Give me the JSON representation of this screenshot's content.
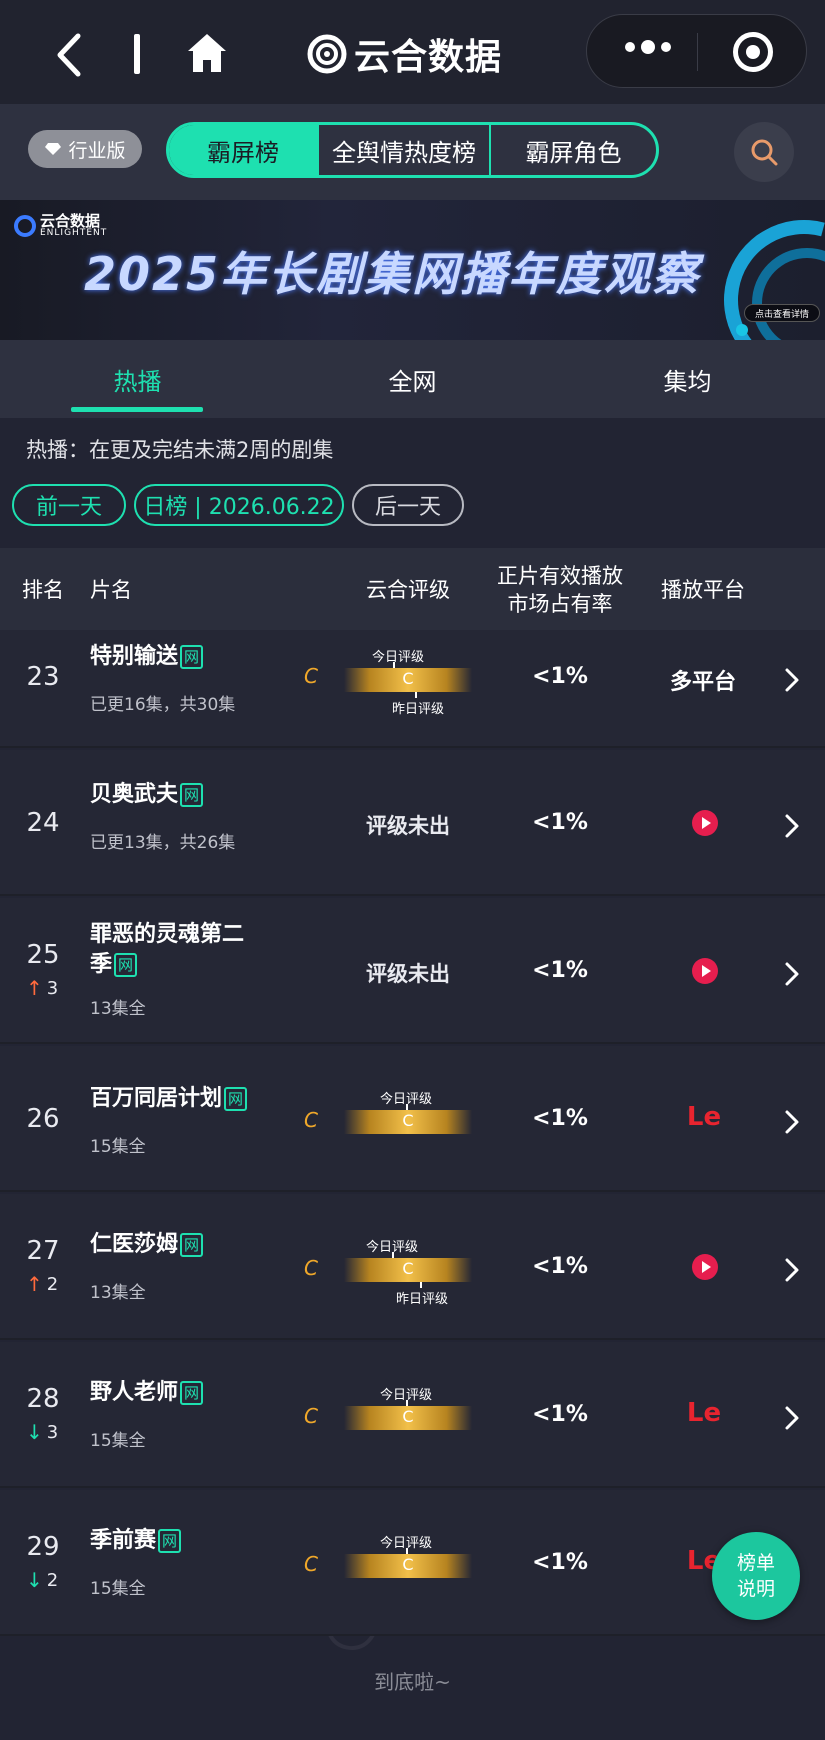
{
  "app": {
    "title": "云合数据"
  },
  "toolbar": {
    "edition_label": "行业版"
  },
  "tabs": [
    {
      "label": "霸屏榜",
      "active": true
    },
    {
      "label": "全舆情热度榜",
      "active": false
    },
    {
      "label": "霸屏角色",
      "active": false
    }
  ],
  "banner": {
    "logo_cn": "云合数据",
    "logo_en": "ENLIGHTENT",
    "title": "2025年长剧集网播年度观察",
    "button": "点击查看详情"
  },
  "subtabs": [
    {
      "label": "热播",
      "active": true
    },
    {
      "label": "全网",
      "active": false
    },
    {
      "label": "集均",
      "active": false
    }
  ],
  "description": "热播：在更及完结未满2周的剧集",
  "datebar": {
    "prev": "前一天",
    "current": "日榜 | 2026.06.22",
    "next": "后一天"
  },
  "table": {
    "headers": {
      "rank": "排名",
      "name": "片名",
      "grade": "云合评级",
      "share_line1": "正片有效播放",
      "share_line2": "市场占有率",
      "platform": "播放平台"
    },
    "rows": [
      {
        "rank": "23",
        "change": "",
        "name": "特别输送",
        "tag": "网",
        "episodes": "已更16集，共30集",
        "grade": "C",
        "grade_mid": "C",
        "label_today": "今日评级",
        "label_yesterday": "昨日评级",
        "share": "<1%",
        "platform": "多平台"
      },
      {
        "rank": "24",
        "change": "",
        "name": "贝奥武夫",
        "tag": "网",
        "episodes": "已更13集，共26集",
        "grade_text": "评级未出",
        "share": "<1%",
        "platform_icon": "youku-icon"
      },
      {
        "rank": "25",
        "change": "3",
        "change_dir": "up",
        "name_line1": "罪恶的灵魂第二",
        "name_line2": "季",
        "tag": "网",
        "episodes": "13集全",
        "grade_text": "评级未出",
        "share": "<1%",
        "platform_icon": "youku-icon"
      },
      {
        "rank": "26",
        "change": "",
        "name": "百万同居计划",
        "tag": "网",
        "episodes": "15集全",
        "grade": "C",
        "grade_mid": "C",
        "label_today": "今日评级",
        "share": "<1%",
        "platform_text": "Le"
      },
      {
        "rank": "27",
        "change": "2",
        "change_dir": "up",
        "name": "仁医莎姆",
        "tag": "网",
        "episodes": "13集全",
        "grade": "C",
        "grade_mid": "C",
        "label_today": "今日评级",
        "label_yesterday": "昨日评级",
        "share": "<1%",
        "platform_icon": "youku-icon"
      },
      {
        "rank": "28",
        "change": "3",
        "change_dir": "down",
        "name": "野人老师",
        "tag": "网",
        "episodes": "15集全",
        "grade": "C",
        "grade_mid": "C",
        "label_today": "今日评级",
        "share": "<1%",
        "platform_text": "Le"
      },
      {
        "rank": "29",
        "change": "2",
        "change_dir": "down",
        "name": "季前赛",
        "tag": "网",
        "episodes": "15集全",
        "grade": "C",
        "grade_mid": "C",
        "label_today": "今日评级",
        "share": "<1%",
        "platform_text": "Le"
      }
    ]
  },
  "footer": {
    "end_text": "到底啦~"
  },
  "float_button": {
    "line1": "榜单",
    "line2": "说明"
  },
  "colors": {
    "accent": "#1ee0b0",
    "grade": "#f0a82a",
    "up": "#ff6a3d",
    "le": "#e8242f",
    "youku": "#e61e4e"
  }
}
